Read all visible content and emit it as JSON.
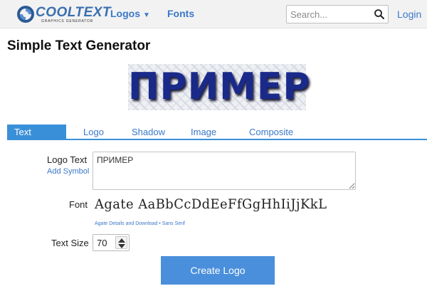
{
  "header": {
    "logo_text": "COOLTEXT",
    "logo_subtext": "GRAPHICS GENERATOR",
    "nav_logos": "Logos",
    "nav_fonts": "Fonts",
    "search_placeholder": "Search...",
    "login": "Login"
  },
  "page": {
    "title": "Simple Text Generator",
    "preview_text": "ПРИМЕР"
  },
  "tabs": [
    "Text",
    "Logo",
    "Shadow",
    "Image",
    "Composite"
  ],
  "active_tab": "Text",
  "form": {
    "logo_text_label": "Logo Text",
    "add_symbol": "Add Symbol",
    "logo_text_value": "ПРИМЕР",
    "font_label": "Font",
    "font_sample": "Agate AaBbCcDdEeFfGgHhIiJjKkL",
    "font_details_link": "Agate Details and Download",
    "font_separator": "•",
    "font_category_link": "Sans Serif",
    "text_size_label": "Text Size",
    "text_size_value": "70",
    "create_button": "Create Logo"
  },
  "colors": {
    "accent": "#3a8fd9",
    "link": "#3a78c9",
    "button": "#4a8fdb",
    "preview_text": "#1a2a8a"
  },
  "icons": {
    "search": "magnifier-icon",
    "caret": "chevron-down-icon",
    "spin_up": "triangle-up-icon",
    "spin_down": "triangle-down-icon"
  }
}
